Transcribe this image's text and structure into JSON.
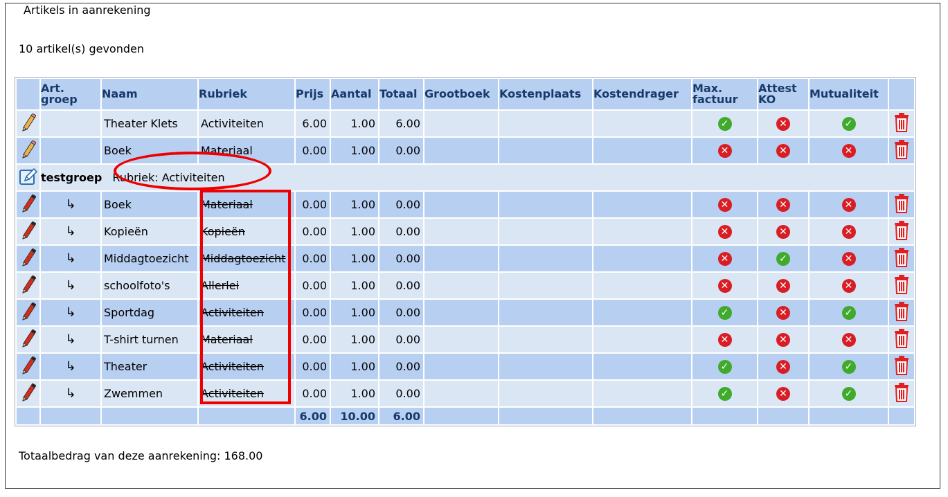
{
  "section": {
    "legend": "Artikels in aanrekening",
    "found_text": "10 artikel(s) gevonden",
    "total_text": "Totaalbedrag van deze aanrekening: 168.00"
  },
  "columns": [
    "Art. groep",
    "Naam",
    "Rubriek",
    "Prijs",
    "Aantal",
    "Totaal",
    "Grootboek",
    "Kostenplaats",
    "Kostendrager",
    "Max. factuur",
    "Attest KO",
    "Mutualiteit"
  ],
  "top_rows": [
    {
      "naam": "Theater Klets",
      "rubriek": "Activiteiten",
      "prijs": "6.00",
      "aantal": "1.00",
      "totaal": "6.00",
      "max": "ok",
      "attest": "no",
      "mut": "ok"
    },
    {
      "naam": "Boek",
      "rubriek": "Materiaal",
      "prijs": "0.00",
      "aantal": "1.00",
      "totaal": "0.00",
      "max": "no",
      "attest": "no",
      "mut": "no"
    }
  ],
  "group": {
    "name": "testgroep",
    "rubriek_label": "Rubriek: Activiteiten"
  },
  "group_rows": [
    {
      "arrow": "↳",
      "naam": "Boek",
      "rubriek": "Materiaal",
      "prijs": "0.00",
      "aantal": "1.00",
      "totaal": "0.00",
      "max": "no",
      "attest": "no",
      "mut": "no"
    },
    {
      "arrow": "↳",
      "naam": "Kopieën",
      "rubriek": "Kopieën",
      "prijs": "0.00",
      "aantal": "1.00",
      "totaal": "0.00",
      "max": "no",
      "attest": "no",
      "mut": "no"
    },
    {
      "arrow": "↳",
      "naam": "Middagtoezicht",
      "rubriek": "Middagtoezicht",
      "prijs": "0.00",
      "aantal": "1.00",
      "totaal": "0.00",
      "max": "no",
      "attest": "ok",
      "mut": "no"
    },
    {
      "arrow": "↳",
      "naam": "schoolfoto's",
      "rubriek": "Allerlei",
      "prijs": "0.00",
      "aantal": "1.00",
      "totaal": "0.00",
      "max": "no",
      "attest": "no",
      "mut": "no"
    },
    {
      "arrow": "↳",
      "naam": "Sportdag",
      "rubriek": "Activiteiten",
      "prijs": "0.00",
      "aantal": "1.00",
      "totaal": "0.00",
      "max": "ok",
      "attest": "no",
      "mut": "ok"
    },
    {
      "arrow": "↳",
      "naam": "T-shirt turnen",
      "rubriek": "Materiaal",
      "prijs": "0.00",
      "aantal": "1.00",
      "totaal": "0.00",
      "max": "no",
      "attest": "no",
      "mut": "no"
    },
    {
      "arrow": "↳",
      "naam": "Theater",
      "rubriek": "Activiteiten",
      "prijs": "0.00",
      "aantal": "1.00",
      "totaal": "0.00",
      "max": "ok",
      "attest": "no",
      "mut": "ok"
    },
    {
      "arrow": "↳",
      "naam": "Zwemmen",
      "rubriek": "Activiteiten",
      "prijs": "0.00",
      "aantal": "1.00",
      "totaal": "0.00",
      "max": "ok",
      "attest": "no",
      "mut": "ok"
    }
  ],
  "footer": {
    "prijs": "6.00",
    "aantal": "10.00",
    "totaal": "6.00"
  },
  "colors": {
    "header_bg": "#b7cff1",
    "row_light": "#dbe6f5",
    "ok": "#3faa2b",
    "no": "#d81e24",
    "annotation": "#e00000"
  },
  "icons": {
    "edit": "pencil-icon",
    "group_edit": "edit-note-icon",
    "delete": "trash-icon",
    "ok": "check-circle-icon",
    "no": "x-circle-icon"
  }
}
